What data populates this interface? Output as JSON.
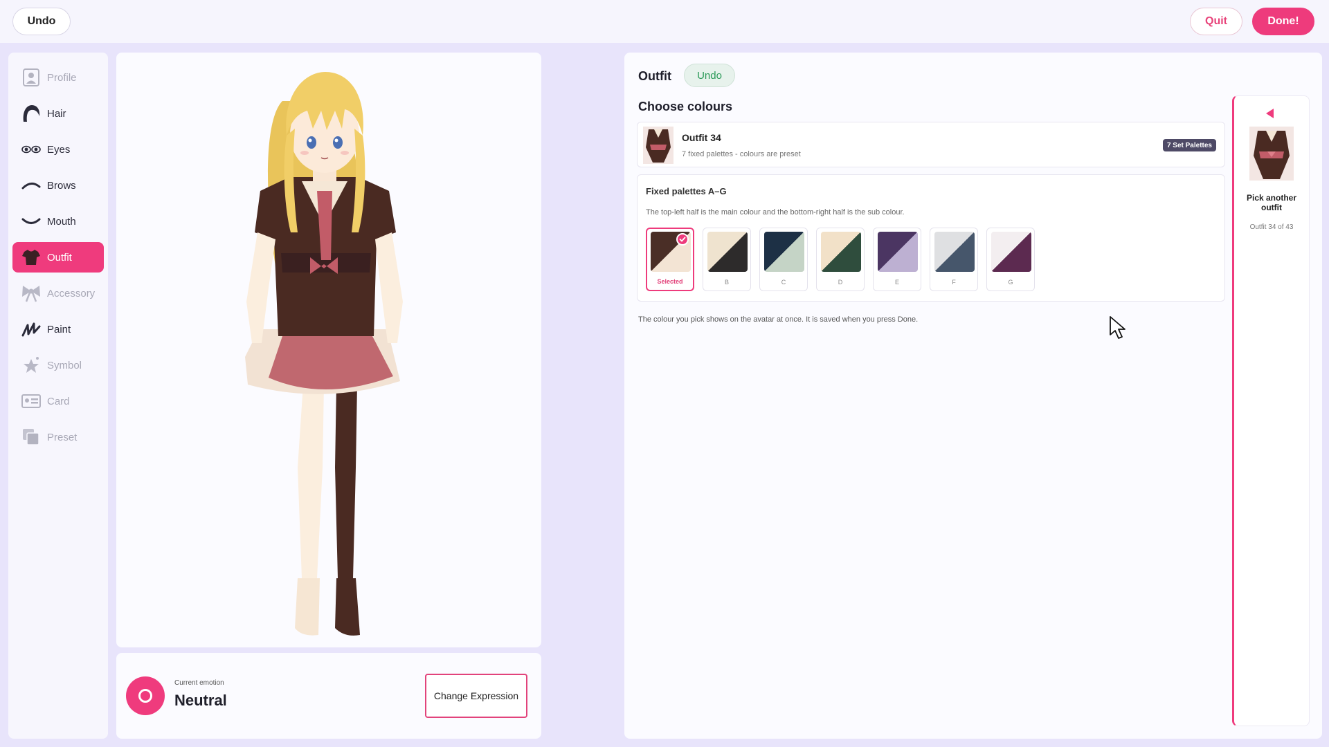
{
  "topbar": {
    "undo_label": "Undo",
    "quit_label": "Quit",
    "done_label": "Done!"
  },
  "sidebar": {
    "items": [
      {
        "label": "Profile",
        "icon": "profile-icon",
        "enabled": false
      },
      {
        "label": "Hair",
        "icon": "hair-icon",
        "enabled": true
      },
      {
        "label": "Eyes",
        "icon": "eyes-icon",
        "enabled": true
      },
      {
        "label": "Brows",
        "icon": "brows-icon",
        "enabled": true
      },
      {
        "label": "Mouth",
        "icon": "mouth-icon",
        "enabled": true
      },
      {
        "label": "Outfit",
        "icon": "outfit-icon",
        "enabled": true,
        "active": true
      },
      {
        "label": "Accessory",
        "icon": "accessory-icon",
        "enabled": false
      },
      {
        "label": "Paint",
        "icon": "paint-icon",
        "enabled": true
      },
      {
        "label": "Symbol",
        "icon": "symbol-icon",
        "enabled": false
      },
      {
        "label": "Card",
        "icon": "card-icon",
        "enabled": false
      },
      {
        "label": "Preset",
        "icon": "preset-icon",
        "enabled": false
      }
    ]
  },
  "emotion": {
    "caption": "Current emotion",
    "value": "Neutral",
    "change_label": "Change Expression"
  },
  "main": {
    "section_title": "Outfit",
    "undo_label": "Undo",
    "choose_title": "Choose colours",
    "outfit": {
      "name": "Outfit 34",
      "description": "7 fixed palettes - colours are preset",
      "badge": "7 Set Palettes"
    },
    "palettes": {
      "title": "Fixed palettes A–G",
      "help": "The top-left half is the main colour and the bottom-right half is the sub colour.",
      "items": [
        {
          "label": "Selected",
          "main": "#4a2e26",
          "sub": "#f3e4d4",
          "selected": true
        },
        {
          "label": "B",
          "main": "#efe3cf",
          "sub": "#2d2b2b",
          "selected": false
        },
        {
          "label": "C",
          "main": "#1d3045",
          "sub": "#c5d4c6",
          "selected": false
        },
        {
          "label": "D",
          "main": "#f2e1c8",
          "sub": "#2f4d3d",
          "selected": false
        },
        {
          "label": "E",
          "main": "#4b3562",
          "sub": "#bdb0d2",
          "selected": false
        },
        {
          "label": "F",
          "main": "#dfe0e2",
          "sub": "#46566b",
          "selected": false
        },
        {
          "label": "G",
          "main": "#f3eef0",
          "sub": "#5c2a50",
          "selected": false
        }
      ]
    },
    "foot_note": "The colour you pick shows on the avatar at once. It is saved when you press Done.",
    "picker": {
      "label": "Pick another outfit",
      "count": "Outfit 34 of 43"
    }
  },
  "colors": {
    "accent": "#ee3b7c",
    "background": "#e8e4fb",
    "panel": "#fbfbff",
    "undo_green": "#2b9a58"
  }
}
